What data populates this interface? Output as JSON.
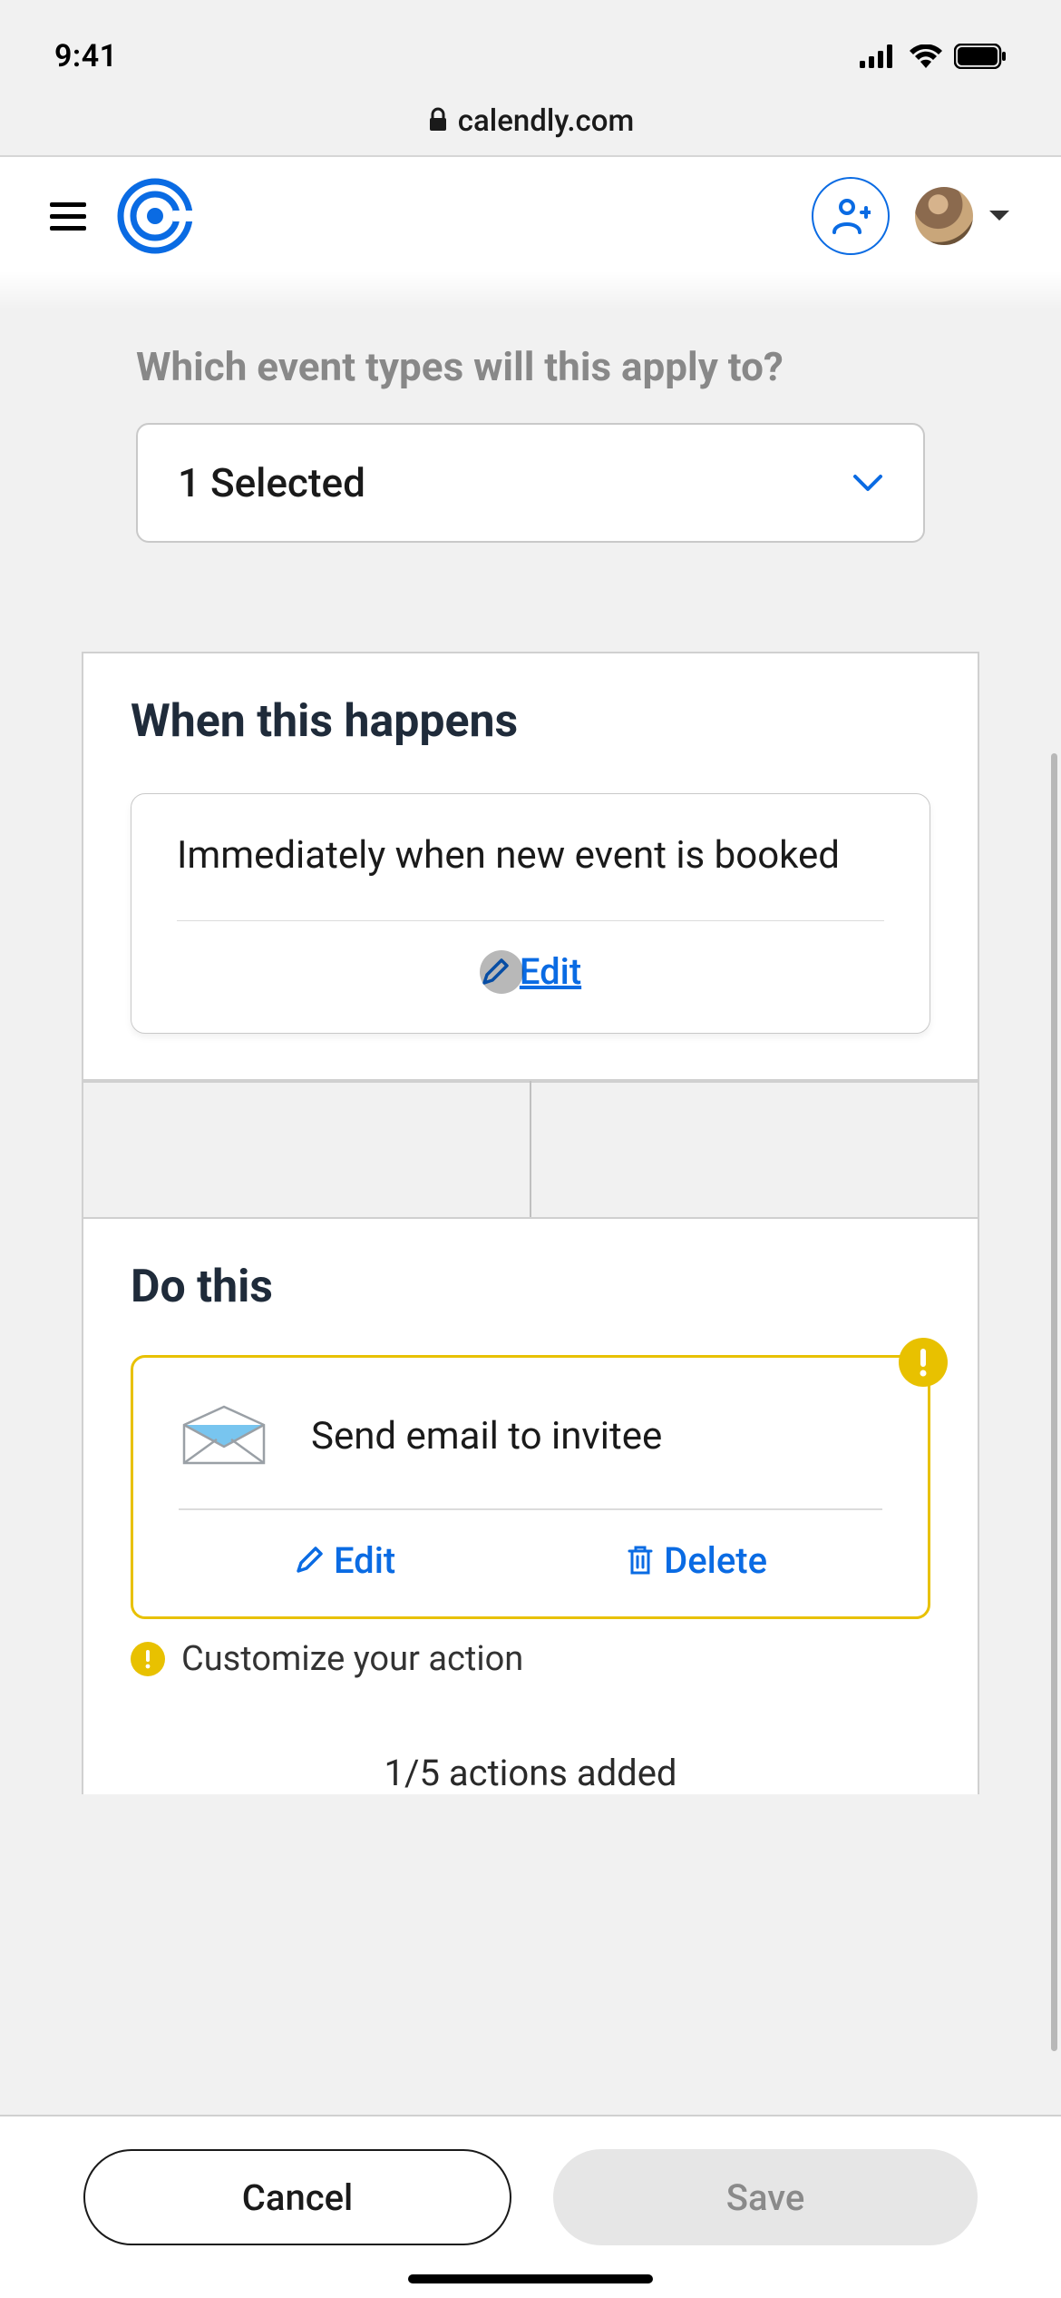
{
  "status": {
    "time": "9:41"
  },
  "url": {
    "domain": "calendly.com"
  },
  "section": {
    "fade_title": "Which event types will this apply to?",
    "select_label": "1 Selected"
  },
  "trigger": {
    "heading": "When this happens",
    "text": "Immediately when new event is booked",
    "edit_label": "Edit"
  },
  "action": {
    "heading": "Do this",
    "text": "Send email to invitee",
    "edit_label": "Edit",
    "delete_label": "Delete",
    "warn_text": "Customize your action",
    "count_text": "1/5 actions added"
  },
  "footer": {
    "cancel": "Cancel",
    "save": "Save"
  },
  "colors": {
    "primary": "#0a6be3",
    "warn": "#e8c100"
  }
}
